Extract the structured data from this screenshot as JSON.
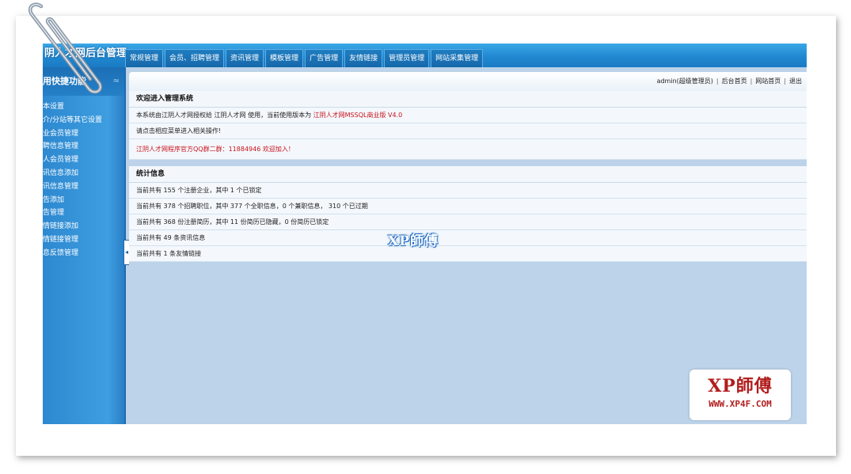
{
  "app": {
    "title": "阴人才网后台管理"
  },
  "nav_tabs": [
    "常规管理",
    "会员、招聘管理",
    "资讯管理",
    "模板管理",
    "广告管理",
    "友情链接",
    "管理员管理",
    "网站采集管理"
  ],
  "sidebar": {
    "header": "用快捷功能",
    "chevron": "≈",
    "items": [
      "本设置",
      "介/分站等其它设置",
      "业会员管理",
      "聘信息管理",
      "人会员管理",
      "讯信息添加",
      "讯信息管理",
      "告添加",
      "告管理",
      "情链接添加",
      "情链接管理",
      "息反馈管理"
    ]
  },
  "userbar": {
    "user": "admin(超级管理员)",
    "links": [
      "后台首页",
      "网站首页",
      "退出"
    ],
    "separator": "|"
  },
  "welcome": {
    "title": "欢迎进入管理系统",
    "line1_prefix": "本系统由江阴人才网授权给 江阴人才网 使用，当前使用版本为 ",
    "line1_version": "江阴人才网MSSQL商业版 V4.0",
    "line2": "请点击相应菜单进入相关操作!",
    "qq": "江阴人才网程序官方QQ群二群：11884946 欢迎加入！"
  },
  "stats": {
    "title": "统计信息",
    "rows": [
      "当前共有 155 个注册企业，其中 1 个已锁定",
      "当前共有 378 个招聘职位，其中 377 个全职信息，0 个兼职信息， 310 个已过期",
      "当前共有 368 份注册简历，其中 11 份简历已隐藏，0 份简历已锁定",
      "当前共有 49 条资讯信息",
      "当前共有 1 条友情链接"
    ]
  },
  "watermark": {
    "center": "XP師傅",
    "logo": "XP師傅",
    "url": "WWW.XP4F.COM"
  },
  "colors": {
    "accent": "#1f86cf",
    "red_text": "#c8101a",
    "logo_red": "#b21d1d"
  }
}
